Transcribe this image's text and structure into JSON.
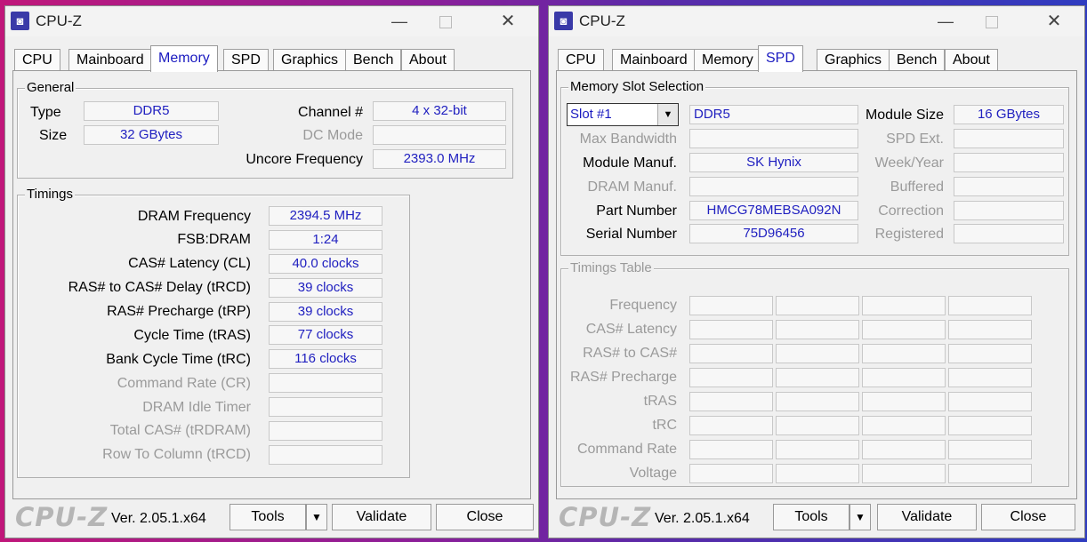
{
  "left": {
    "title": "CPU-Z",
    "tabs": [
      "CPU",
      "Mainboard",
      "Memory",
      "SPD",
      "Graphics",
      "Bench",
      "About"
    ],
    "active_tab": "Memory",
    "general": {
      "label": "General",
      "type_label": "Type",
      "type_value": "DDR5",
      "size_label": "Size",
      "size_value": "32 GBytes",
      "channel_label": "Channel #",
      "channel_value": "4 x 32-bit",
      "dcmode_label": "DC Mode",
      "dcmode_value": "",
      "uncore_label": "Uncore Frequency",
      "uncore_value": "2393.0 MHz"
    },
    "timings": {
      "label": "Timings",
      "rows": [
        {
          "label": "DRAM Frequency",
          "value": "2394.5 MHz"
        },
        {
          "label": "FSB:DRAM",
          "value": "1:24"
        },
        {
          "label": "CAS# Latency (CL)",
          "value": "40.0 clocks"
        },
        {
          "label": "RAS# to CAS# Delay (tRCD)",
          "value": "39 clocks"
        },
        {
          "label": "RAS# Precharge (tRP)",
          "value": "39 clocks"
        },
        {
          "label": "Cycle Time (tRAS)",
          "value": "77 clocks"
        },
        {
          "label": "Bank Cycle Time (tRC)",
          "value": "116 clocks"
        },
        {
          "label": "Command Rate (CR)",
          "value": ""
        },
        {
          "label": "DRAM Idle Timer",
          "value": ""
        },
        {
          "label": "Total CAS# (tRDRAM)",
          "value": ""
        },
        {
          "label": "Row To Column (tRCD)",
          "value": ""
        }
      ]
    },
    "footer": {
      "brand": "CPU-Z",
      "version": "Ver. 2.05.1.x64",
      "tools": "Tools",
      "validate": "Validate",
      "close": "Close"
    }
  },
  "right": {
    "title": "CPU-Z",
    "tabs": [
      "CPU",
      "Mainboard",
      "Memory",
      "SPD",
      "Graphics",
      "Bench",
      "About"
    ],
    "active_tab": "SPD",
    "slot": {
      "label": "Memory Slot Selection",
      "slot_value": "Slot #1",
      "type_value": "DDR5",
      "module_size_label": "Module Size",
      "module_size_value": "16 GBytes",
      "max_bw_label": "Max Bandwidth",
      "max_bw_value": "",
      "spd_ext_label": "SPD Ext.",
      "spd_ext_value": "",
      "manuf_label": "Module Manuf.",
      "manuf_value": "SK Hynix",
      "weekyear_label": "Week/Year",
      "weekyear_value": "",
      "dram_manuf_label": "DRAM Manuf.",
      "dram_manuf_value": "",
      "buffered_label": "Buffered",
      "buffered_value": "",
      "part_label": "Part Number",
      "part_value": "HMCG78MEBSA092N",
      "correction_label": "Correction",
      "correction_value": "",
      "serial_label": "Serial Number",
      "serial_value": "75D96456",
      "registered_label": "Registered",
      "registered_value": ""
    },
    "timings_table": {
      "label": "Timings Table",
      "rows": [
        "Frequency",
        "CAS# Latency",
        "RAS# to CAS#",
        "RAS# Precharge",
        "tRAS",
        "tRC",
        "Command Rate",
        "Voltage"
      ]
    },
    "footer": {
      "brand": "CPU-Z",
      "version": "Ver. 2.05.1.x64",
      "tools": "Tools",
      "validate": "Validate",
      "close": "Close"
    }
  }
}
